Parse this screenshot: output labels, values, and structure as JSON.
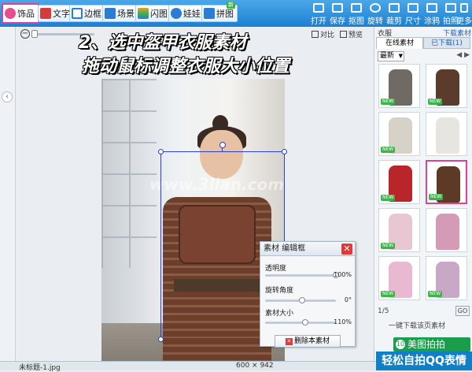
{
  "toolbar": {
    "tabs": [
      {
        "label": "饰品",
        "icon": "heart-icon",
        "color": "#e84c8a"
      },
      {
        "label": "文字",
        "icon": "text-icon",
        "color": "#d83a3a"
      },
      {
        "label": "边框",
        "icon": "frame-icon",
        "color": "#2a7dd6"
      },
      {
        "label": "场景",
        "icon": "scene-icon",
        "color": "#2a7dd6"
      },
      {
        "label": "闪图",
        "icon": "flash-icon",
        "color": "#f0a020"
      },
      {
        "label": "娃娃",
        "icon": "doll-icon",
        "color": "#2a7dd6"
      },
      {
        "label": "拼图",
        "icon": "puzzle-icon",
        "color": "#2a7dd6"
      }
    ],
    "new_badge": "新",
    "tools": [
      "打开",
      "保存",
      "抠图",
      "旋转",
      "裁剪",
      "尺寸",
      "涂鸦",
      "拍照",
      "更多"
    ]
  },
  "canvas_toolbar": {
    "zoom_icon": "−",
    "compare_label": "对比",
    "preview_label": "预览"
  },
  "annotation": {
    "line1": "2、选中盔甲衣服素材",
    "line2": "拖动鼠标调整衣服大小位置"
  },
  "watermark": "www.3lian.com",
  "property_panel": {
    "title": "素材 编辑框",
    "close": "✕",
    "opacity_label": "透明度",
    "opacity_value": "100%",
    "opacity": 1.0,
    "rotation_label": "旋转角度",
    "rotation_value": "0°",
    "rotation": 0,
    "size_label": "素材大小",
    "size_value": "110%",
    "size": 1.1,
    "delete_label": "删除本素材"
  },
  "right_panel": {
    "category": "衣服",
    "download_more": "下载素材",
    "tab_online": "在线素材",
    "tab_downloaded": "已下载(1)",
    "filter": "最新",
    "new_tag": "NEW",
    "thumbnails": [
      {
        "color": "#6f6a64",
        "new": true
      },
      {
        "color": "#5a3b2c",
        "new": true
      },
      {
        "color": "#d7d2c7",
        "new": true
      },
      {
        "color": "#e7e5e0",
        "new": false
      },
      {
        "color": "#b8262a",
        "new": true
      },
      {
        "color": "#5c3a26",
        "new": true,
        "selected": true
      },
      {
        "color": "#e8c7d3",
        "new": true
      },
      {
        "color": "#d59ab6",
        "new": false
      },
      {
        "color": "#e9b9d2",
        "new": true
      },
      {
        "color": "#c8a7c7",
        "new": true
      }
    ],
    "page_label": "1/5",
    "go_label": "GO",
    "download_all": "一键下载该页素材"
  },
  "promo": {
    "top": "美图拍拍",
    "top_icon": "10",
    "bottom": "轻松自拍QQ表情"
  },
  "status": {
    "filename": "未标题-1.jpg",
    "dimensions": "600 × 942"
  }
}
